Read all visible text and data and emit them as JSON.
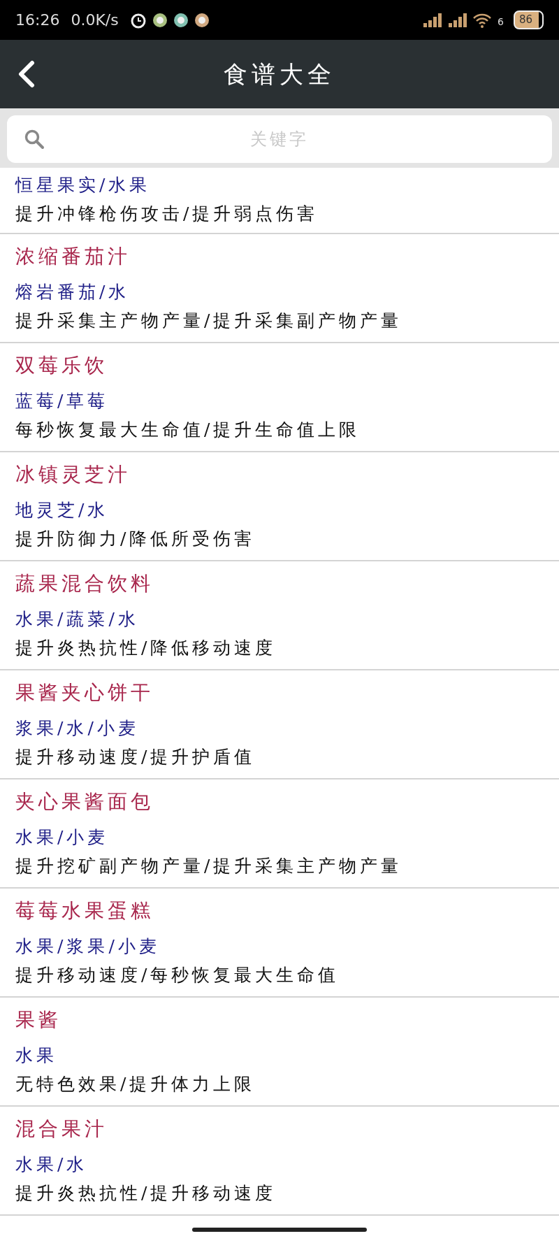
{
  "status_bar": {
    "time": "16:26",
    "speed": "0.0K/s",
    "battery": "86",
    "wifi_label": "6"
  },
  "header": {
    "title": "食谱大全"
  },
  "search": {
    "placeholder": "关键字"
  },
  "partial_item": {
    "ingredients": "恒星果实/水果",
    "effect": "提升冲锋枪伤攻击/提升弱点伤害"
  },
  "recipes": [
    {
      "name": "浓缩番茄汁",
      "ingredients": "熔岩番茄/水",
      "effect": "提升采集主产物产量/提升采集副产物产量"
    },
    {
      "name": "双莓乐饮",
      "ingredients": "蓝莓/草莓",
      "effect": "每秒恢复最大生命值/提升生命值上限"
    },
    {
      "name": "冰镇灵芝汁",
      "ingredients": "地灵芝/水",
      "effect": "提升防御力/降低所受伤害"
    },
    {
      "name": "蔬果混合饮料",
      "ingredients": "水果/蔬菜/水",
      "effect": "提升炎热抗性/降低移动速度"
    },
    {
      "name": "果酱夹心饼干",
      "ingredients": "浆果/水/小麦",
      "effect": "提升移动速度/提升护盾值"
    },
    {
      "name": "夹心果酱面包",
      "ingredients": "水果/小麦",
      "effect": "提升挖矿副产物产量/提升采集主产物产量"
    },
    {
      "name": "莓莓水果蛋糕",
      "ingredients": "水果/浆果/小麦",
      "effect": "提升移动速度/每秒恢复最大生命值"
    },
    {
      "name": "果酱",
      "ingredients": "水果",
      "effect": "无特色效果/提升体力上限"
    },
    {
      "name": "混合果汁",
      "ingredients": "水果/水",
      "effect": "提升炎热抗性/提升移动速度"
    }
  ]
}
